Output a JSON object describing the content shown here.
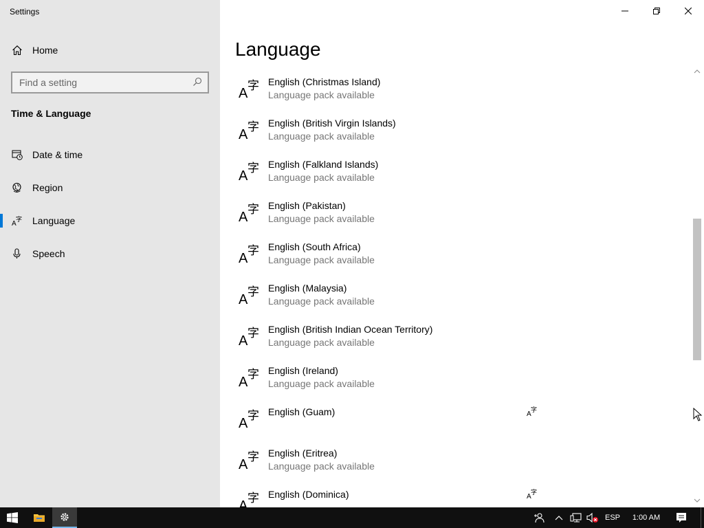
{
  "window": {
    "title": "Settings"
  },
  "sidebar": {
    "home_label": "Home",
    "search_placeholder": "Find a setting",
    "section_title": "Time & Language",
    "items": [
      {
        "label": "Date & time",
        "icon": "calendar-clock-icon"
      },
      {
        "label": "Region",
        "icon": "globe-icon"
      },
      {
        "label": "Language",
        "icon": "language-icon",
        "selected": true
      },
      {
        "label": "Speech",
        "icon": "microphone-icon"
      }
    ]
  },
  "main": {
    "page_title": "Language",
    "languages": [
      {
        "name": "English (Christmas Island)",
        "status": "Language pack available"
      },
      {
        "name": "English (British Virgin Islands)",
        "status": "Language pack available"
      },
      {
        "name": "English (Falkland Islands)",
        "status": "Language pack available"
      },
      {
        "name": "English (Pakistan)",
        "status": "Language pack available"
      },
      {
        "name": "English (South Africa)",
        "status": "Language pack available"
      },
      {
        "name": "English (Malaysia)",
        "status": "Language pack available"
      },
      {
        "name": "English (British Indian Ocean Territory)",
        "status": "Language pack available"
      },
      {
        "name": "English (Ireland)",
        "status": "Language pack available"
      },
      {
        "name": "English (Guam)",
        "status": "",
        "feature_icon": "language-feature-icon"
      },
      {
        "name": "English (Eritrea)",
        "status": "Language pack available"
      },
      {
        "name": "English (Dominica)",
        "status": "",
        "feature_icon": "language-feature-icon"
      }
    ]
  },
  "taskbar": {
    "language_indicator": "ESP",
    "time": "1:00 AM"
  },
  "colors": {
    "accent": "#0078d7",
    "sidebar_bg": "#e6e6e6",
    "taskbar_bg": "#101010",
    "secondary_text": "#767676"
  }
}
